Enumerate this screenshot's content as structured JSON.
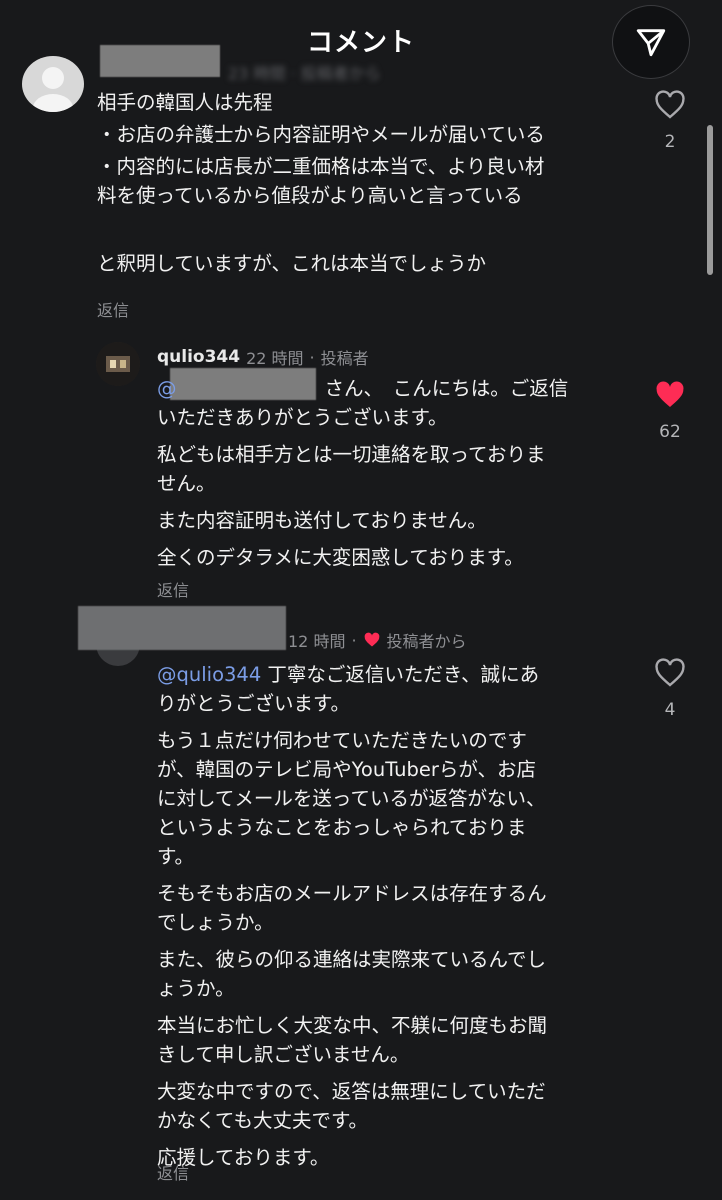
{
  "header": {
    "title": "コメント"
  },
  "comment1": {
    "meta": "23 時間 · 投稿者から",
    "lines": [
      "相手の韓国人は先程",
      "・お店の弁護士から内容証明やメールが届いている",
      "・内容的には店長が二重価格は本当で、より良い材",
      "料を使っているから値段がより高いと言っている",
      "と釈明していますが、これは本当でしょうか"
    ],
    "reply_label": "返信",
    "likes": "2"
  },
  "comment2": {
    "username": "qulio344",
    "time": "22 時間",
    "tag": "投稿者",
    "mention_suffix": "さん、　こんにちは。ご返信",
    "lines": [
      "いただきありがとうございます。",
      "私どもは相手方とは一切連絡を取っておりま",
      "せん。",
      "また内容証明も送付しておりません。",
      "全くのデタラメに大変困惑しております。"
    ],
    "reply_label": "返信",
    "likes": "62"
  },
  "comment3": {
    "time": "12 時間",
    "tag": "投稿者から",
    "mention": "@qulio344",
    "first_line": " 丁寧なご返信いただき、誠にあ",
    "lines": [
      "りがとうございます。",
      "もう１点だけ伺わせていただきたいのです",
      "が、韓国のテレビ局やYouTuberらが、お店",
      "に対してメールを送っているが返答がない、",
      "というようなことをおっしゃられておりま",
      "す。",
      "そもそもお店のメールアドレスは存在するん",
      "でしょうか。",
      "また、彼らの仰る連絡は実際来ているんでし",
      "ょうか。",
      "本当にお忙しく大変な中、不躾に何度もお聞",
      "きして申し訳ございません。",
      "大変な中ですので、返答は無理にしていただ",
      "かなくても大丈夫です。",
      "応援しております。"
    ],
    "reply_label": "返信",
    "likes": "4"
  },
  "colors": {
    "background": "#18191b",
    "like_red": "#fe2c55",
    "mention": "#7b9de6"
  }
}
